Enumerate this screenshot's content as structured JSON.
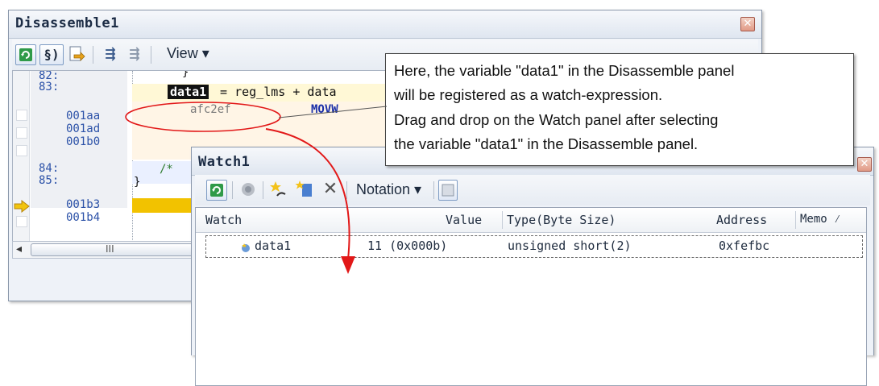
{
  "disassemble": {
    "title": "Disassemble1",
    "close_glyph": "✕",
    "toolbar": {
      "view_menu": "View ▾"
    },
    "line_numbers": [
      "82:",
      "83:",
      "84:",
      "85:"
    ],
    "addresses": [
      "001aa",
      "001ad",
      "001b0",
      "001b3",
      "001b4"
    ],
    "code": {
      "brace_top": "}",
      "selected_variable": "data1",
      "statement_rest": " = reg_lms + data",
      "asm_address": "afc2ef",
      "asm_mnemonic": "MOVW",
      "comment_start": "/*",
      "brace_bottom": "}"
    },
    "hscroll_grip": "III",
    "hscroll_left_arrow": "◂"
  },
  "watch": {
    "title": "Watch1",
    "close_glyph": "✕",
    "toolbar": {
      "notation_menu": "Notation ▾",
      "delete_glyph": "✕"
    },
    "columns": {
      "watch": "Watch",
      "value": "Value",
      "type": "Type(Byte Size)",
      "address": "Address",
      "memo": "Memo ⁄"
    },
    "rows": [
      {
        "name": "data1",
        "value": "11 (0x000b)",
        "type": "unsigned short(2)",
        "address": "0xfefbc"
      }
    ]
  },
  "callout": {
    "lines": [
      "Here, the variable \"data1\" in the Disassemble panel",
      "will be registered as a watch-expression.",
      "Drag and drop on the Watch panel after selecting",
      "the variable \"data1\" in the Disassemble panel."
    ]
  },
  "colors": {
    "arrow": "#e21818",
    "current_line": "#f2c200",
    "selection": "#111111"
  }
}
